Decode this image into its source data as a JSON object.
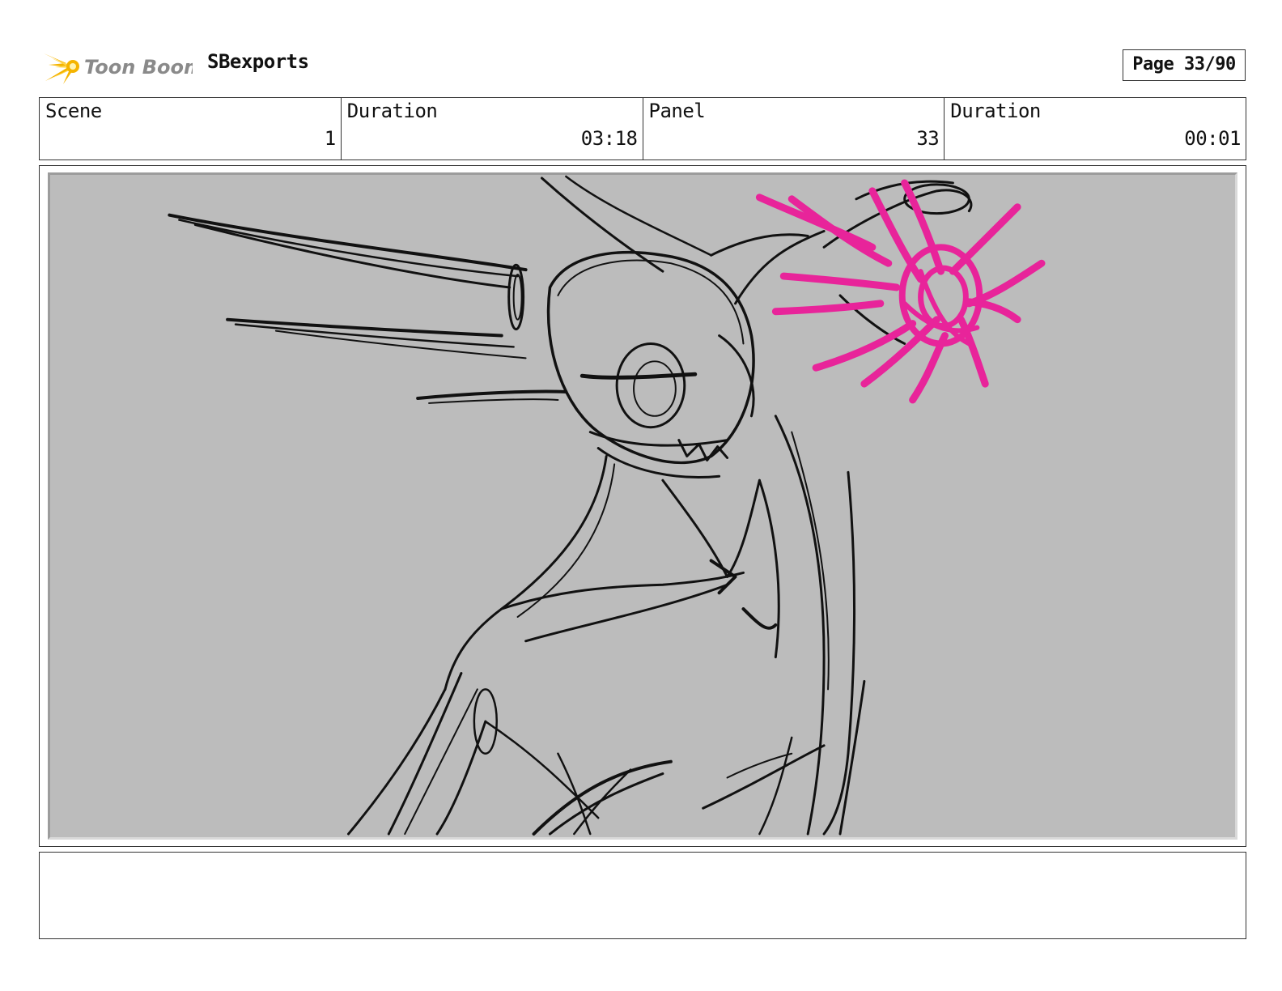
{
  "header": {
    "logo_text": "Toon Boom",
    "project_title": "SBexports",
    "page_number": "Page 33/90"
  },
  "info": {
    "scene_label": "Scene",
    "scene_value": "1",
    "scene_duration_label": "Duration",
    "scene_duration_value": "03:18",
    "panel_label": "Panel",
    "panel_value": "33",
    "panel_duration_label": "Duration",
    "panel_duration_value": "00:01"
  },
  "panel": {
    "background_color": "#bcbcbc",
    "sketch_color": "#111111",
    "effect_color": "#e8249a"
  },
  "notes": {
    "text": ""
  }
}
